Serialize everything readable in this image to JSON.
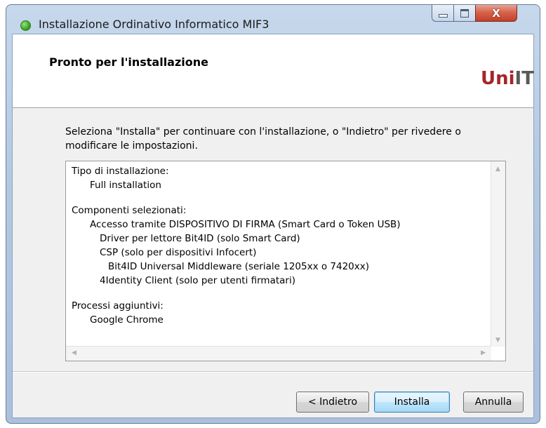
{
  "window": {
    "title": "Installazione Ordinativo Informatico MIF3",
    "close_symbol": "X"
  },
  "header": {
    "title": "Pronto per l'installazione",
    "logo_part1": "Uni",
    "logo_part2": "IT",
    "logo_colors": {
      "uni": "#a3262a",
      "it": "#5a5a5a"
    }
  },
  "intro": {
    "line1": "Seleziona \"Installa\" per continuare con l'installazione, o \"Indietro\" per rivedere o",
    "line2": "modificare le impostazioni."
  },
  "summary": {
    "install_type_label": "Tipo di installazione:",
    "install_type_value": "Full installation",
    "components_label": "Componenti selezionati:",
    "component_access": "Accesso tramite DISPOSITIVO DI FIRMA (Smart Card o Token USB)",
    "component_driver": "Driver per lettore Bit4ID (solo Smart Card)",
    "component_csp": "CSP (solo per dispositivi Infocert)",
    "component_middleware": "Bit4ID Universal Middleware (seriale 1205xx o 7420xx)",
    "component_4identity": "4Identity Client (solo per utenti firmatari)",
    "extra_label": "Processi aggiuntivi:",
    "extra_chrome": "Google Chrome"
  },
  "buttons": {
    "back": "< Indietro",
    "install": "Installa",
    "cancel": "Annulla"
  },
  "icons": {
    "app": "green-circle-icon",
    "minimize": "minimize-icon",
    "maximize": "maximize-icon",
    "close": "close-icon"
  }
}
